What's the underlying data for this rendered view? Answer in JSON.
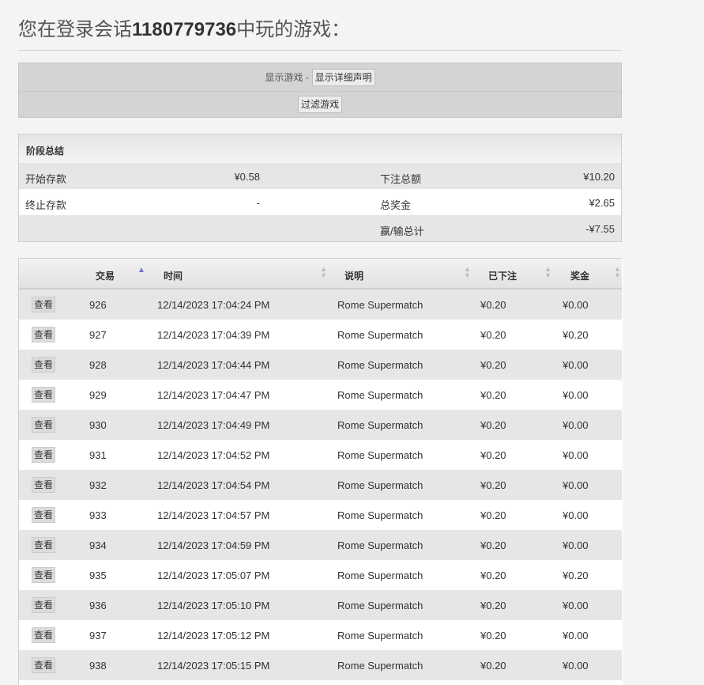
{
  "page": {
    "title_prefix": "您在登录会话",
    "session_id": "1180779736",
    "title_suffix": "中玩的游戏："
  },
  "filter": {
    "show_games_label": "显示游戏 -",
    "show_detail_button": "显示详细声明",
    "filter_button": "过滤游戏"
  },
  "summary": {
    "heading": "阶段总结",
    "rows": [
      {
        "label1": "开始存款",
        "value1": "¥0.58",
        "label2": "下注总额",
        "value2": "¥10.20"
      },
      {
        "label1": "终止存款",
        "value1": "-",
        "label2": "总奖金",
        "value2": "¥2.65"
      },
      {
        "label1": "",
        "value1": "",
        "label2": "赢/输总计",
        "value2": "-¥7.55"
      }
    ]
  },
  "games": {
    "columns": {
      "transaction": "交易",
      "time": "时间",
      "description": "说明",
      "bet": "已下注",
      "win": "奖金"
    },
    "view_label": "查看",
    "rows": [
      {
        "id": "926",
        "time": "12/14/2023 17:04:24 PM",
        "desc": "Rome Supermatch",
        "bet": "¥0.20",
        "win": "¥0.00"
      },
      {
        "id": "927",
        "time": "12/14/2023 17:04:39 PM",
        "desc": "Rome Supermatch",
        "bet": "¥0.20",
        "win": "¥0.20"
      },
      {
        "id": "928",
        "time": "12/14/2023 17:04:44 PM",
        "desc": "Rome Supermatch",
        "bet": "¥0.20",
        "win": "¥0.00"
      },
      {
        "id": "929",
        "time": "12/14/2023 17:04:47 PM",
        "desc": "Rome Supermatch",
        "bet": "¥0.20",
        "win": "¥0.00"
      },
      {
        "id": "930",
        "time": "12/14/2023 17:04:49 PM",
        "desc": "Rome Supermatch",
        "bet": "¥0.20",
        "win": "¥0.00"
      },
      {
        "id": "931",
        "time": "12/14/2023 17:04:52 PM",
        "desc": "Rome Supermatch",
        "bet": "¥0.20",
        "win": "¥0.00"
      },
      {
        "id": "932",
        "time": "12/14/2023 17:04:54 PM",
        "desc": "Rome Supermatch",
        "bet": "¥0.20",
        "win": "¥0.00"
      },
      {
        "id": "933",
        "time": "12/14/2023 17:04:57 PM",
        "desc": "Rome Supermatch",
        "bet": "¥0.20",
        "win": "¥0.00"
      },
      {
        "id": "934",
        "time": "12/14/2023 17:04:59 PM",
        "desc": "Rome Supermatch",
        "bet": "¥0.20",
        "win": "¥0.00"
      },
      {
        "id": "935",
        "time": "12/14/2023 17:05:07 PM",
        "desc": "Rome Supermatch",
        "bet": "¥0.20",
        "win": "¥0.20"
      },
      {
        "id": "936",
        "time": "12/14/2023 17:05:10 PM",
        "desc": "Rome Supermatch",
        "bet": "¥0.20",
        "win": "¥0.00"
      },
      {
        "id": "937",
        "time": "12/14/2023 17:05:12 PM",
        "desc": "Rome Supermatch",
        "bet": "¥0.20",
        "win": "¥0.00"
      },
      {
        "id": "938",
        "time": "12/14/2023 17:05:15 PM",
        "desc": "Rome Supermatch",
        "bet": "¥0.20",
        "win": "¥0.00"
      }
    ]
  },
  "icons": {
    "sort_both": "sort-both-icon",
    "sort_asc": "sort-ascending-icon"
  },
  "colors": {
    "sort_active": "#6a75c8",
    "row_alt": "#e6e6e6"
  }
}
